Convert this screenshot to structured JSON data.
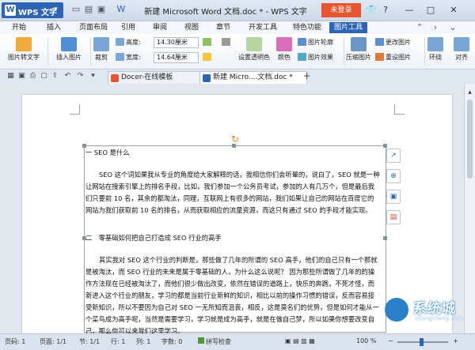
{
  "titlebar": {
    "app_name": "WPS 文字",
    "document_title": "新建 Microsoft Word 文档.doc * - WPS 文字",
    "login_label": "未登录",
    "window_controls": [
      "shirt-icon",
      "help-icon",
      "minimize-icon",
      "maximize-icon",
      "close-icon"
    ]
  },
  "menu": {
    "tabs": [
      "开始",
      "插入",
      "页面布局",
      "引用",
      "审阅",
      "视图",
      "章节",
      "开发工具",
      "特色功能",
      "图片工具"
    ],
    "active": "图片工具"
  },
  "ribbon": {
    "image_to_text": "图片转文字",
    "insert_image": "插入图片",
    "crop": "裁剪",
    "height_label": "高度:",
    "height_value": "14.30厘米",
    "width_label": "宽度:",
    "width_value": "14.64厘米",
    "set_transparent": "设置透明色",
    "color": "颜色",
    "image_outline": "图片轮廓",
    "image_effects": "图片效果",
    "compress": "压缩图片",
    "change_image": "更改图片",
    "reset_image": "重设图片",
    "wrap": "环绕",
    "align": "对齐"
  },
  "tabstrip": {
    "tabs": [
      {
        "label": "Docer-在线模板",
        "active": false
      },
      {
        "label": "新建 Micro....文档.doc *",
        "active": true
      }
    ],
    "add": "+"
  },
  "document": {
    "heading1": "一 SEO 是什么",
    "para1": "SEO 这个词如果我从专业的角度给大家解释的话，我相信你们会听晕的，说白了，SEO 就是一种让网站在搜索引擎上的排名手段，比如，我们参加一个公务员考试，参加的人有几万个，但是最后我们只要前 10 名，其余的都淘汰，同理，互联网上有很多的网站，我们如果让自己的网站在百度它的网站为我们获取前 10 名的排名，从而获取相应的流量资源，而这只有通过 SEO 的手段才能实现。",
    "heading2": "二　零基础如何把自己打造成 SEO 行业的高手",
    "para2": "其实我对 SEO 这个行业的判断是，那些做了几年的所谓的 SEO 高手，他们的自己只有一个那就是被淘汰，而 SEO 行业的未来是属于零基础的人，为什么这么说呢？ 因为那些所谓做了几年的的操作方法现在已经被淘汰了，而他们很少做出改变，依然在错误的道路上，快乐的奔跑，不死才怪，而新进入这个行业的朋友，学习的都是当前行业新鲜的知识，相比以前的操作习惯的错误，反而容易接受新知识，所以不要因为自己对 SEO 一无所知而沮丧，相反，这是莫名们的优势，但是如何才能从一个菜鸟成为高手呢，当然是需要学习，学习就是成为高手，就是在做自己梦，所以如果你想要改变自己，那么你可以来我们这里学习。"
  },
  "statusbar": {
    "page_num": "页码: 1",
    "page_of": "页面: 1/1",
    "section": "节: 1/1",
    "line": "行: 1",
    "column": "列: 1",
    "word_count": "字数: 0",
    "spellcheck": "拼写检查",
    "zoom": "100 %"
  },
  "watermark": {
    "brand": "系统城",
    "url": "xitongcheng.com"
  },
  "colors": {
    "brand_blue": "#2e64b4",
    "login_orange": "#e8542e",
    "rotate_handle": "#e58a1f"
  }
}
